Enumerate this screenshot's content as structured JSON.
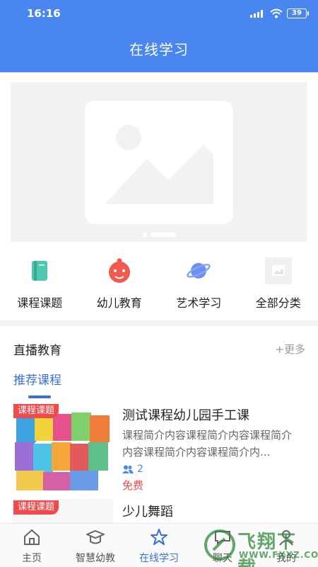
{
  "status": {
    "time": "16:16",
    "battery": "39"
  },
  "header": {
    "title": "在线学习"
  },
  "banner": {
    "slides": 2,
    "active_index": 1
  },
  "categories": [
    {
      "label": "课程课题",
      "icon": "book-icon"
    },
    {
      "label": "幼儿教育",
      "icon": "baby-face-icon"
    },
    {
      "label": "艺术学习",
      "icon": "planet-icon"
    },
    {
      "label": "全部分类",
      "icon": "image-placeholder-icon"
    }
  ],
  "section": {
    "title": "直播教育",
    "more": "+更多"
  },
  "recommend_tab": "推荐课程",
  "courses": [
    {
      "tag": "课程课题",
      "title": "测试课程幼儿园手工课",
      "desc": "课程简介内容课程简介内容课程简介内容课程简介内容课程简介内...",
      "students": "2",
      "price": "免费"
    },
    {
      "tag": "课程课题",
      "title": "少儿舞蹈"
    }
  ],
  "tabbar": [
    {
      "label": "主页",
      "icon": "home-icon",
      "active": false
    },
    {
      "label": "智慧幼教",
      "icon": "graduation-cap-icon",
      "active": false
    },
    {
      "label": "在线学习",
      "icon": "star-icon",
      "active": true
    },
    {
      "label": "聊天",
      "icon": "chat-icon",
      "active": false
    },
    {
      "label": "我的",
      "icon": "user-icon",
      "active": false
    }
  ],
  "colors": {
    "primary": "#4a86ef",
    "accent_red": "#f04a4a",
    "link_blue": "#3a6fd8"
  },
  "watermark": {
    "text": "飞翔下载",
    "url": "WWW.FXXZ.COM"
  }
}
